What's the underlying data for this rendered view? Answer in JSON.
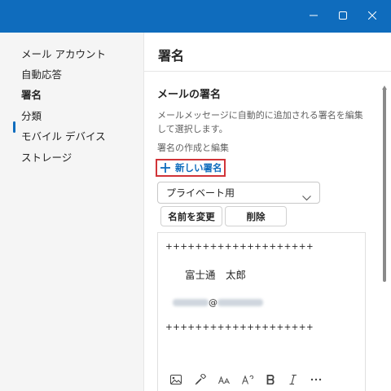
{
  "window": {
    "controls": [
      "minimize-icon",
      "maximize-icon",
      "close-icon"
    ],
    "titlebar_color": "#0f6cbd"
  },
  "sidebar": {
    "items": [
      {
        "label": "メール アカウント",
        "active": false
      },
      {
        "label": "自動応答",
        "active": false
      },
      {
        "label": "署名",
        "active": true
      },
      {
        "label": "分類",
        "active": false
      },
      {
        "label": "モバイル デバイス",
        "active": false
      },
      {
        "label": "ストレージ",
        "active": false
      }
    ],
    "accent_color": "#0f6cbd"
  },
  "main": {
    "title": "署名",
    "section_title": "メールの署名",
    "description": "メールメッセージに自動的に追加される署名を編集して選択します。",
    "create_label": "署名の作成と編集",
    "new_signature_label": "新しい署名",
    "selected_signature": "プライベート用",
    "rename_label": "名前を変更",
    "delete_label": "削除",
    "highlight_color": "#d13438"
  },
  "editor": {
    "line1": "++++++++++++++++++++",
    "name": "富士通　太郎",
    "email_at": "@",
    "line2": "++++++++++++++++++++",
    "toolbar": [
      "image-icon",
      "format-painter-icon",
      "font-size-icon",
      "superscript-icon",
      "bold-icon",
      "italic-icon",
      "more-icon"
    ]
  }
}
